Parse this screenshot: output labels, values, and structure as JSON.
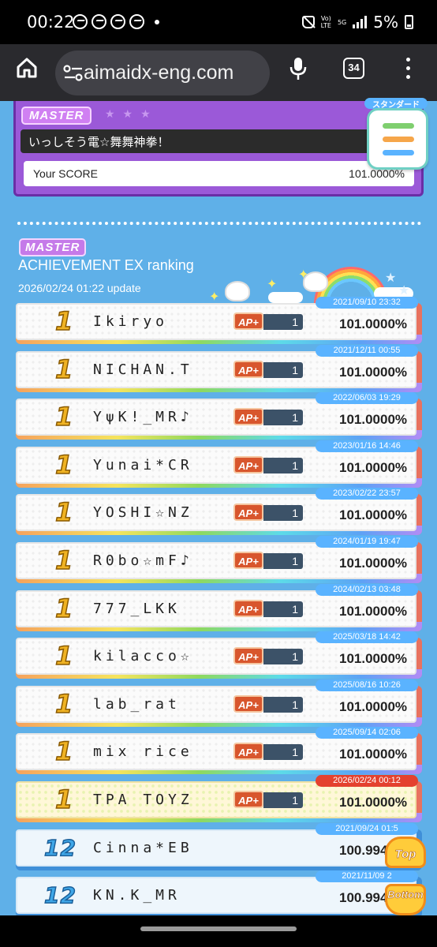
{
  "status_bar": {
    "time": "00:22",
    "network_top": "Vo)",
    "network_bottom": "LTE",
    "five_g": "5G",
    "battery": "5%",
    "notification_icons": [
      "whatsapp-icon",
      "messenger-icon",
      "messenger-icon",
      "messenger-icon"
    ]
  },
  "browser": {
    "url": "aimaidx-eng.com",
    "tab_count": "34"
  },
  "song": {
    "difficulty": "MASTER",
    "title": "いっしそう電☆舞舞神拳！",
    "score_label": "Your SCORE",
    "score_value": "101.0000%",
    "corner_badge": "スタンダード"
  },
  "ranking": {
    "difficulty": "MASTER",
    "title": "ACHIEVEMENT EX ranking",
    "updated": "2026/02/24 01:22 update",
    "ap_label": "AP+",
    "rows": [
      {
        "rank": "1",
        "name": "Ikiryo",
        "ap_count": "1",
        "date": "2021/09/10 23:32",
        "score": "101.0000%"
      },
      {
        "rank": "1",
        "name": "NICHAN.T",
        "ap_count": "1",
        "date": "2021/12/11 00:55",
        "score": "101.0000%"
      },
      {
        "rank": "1",
        "name": "YψK!_MR♪",
        "ap_count": "1",
        "date": "2022/06/03 19:29",
        "score": "101.0000%"
      },
      {
        "rank": "1",
        "name": "Yunai*CR",
        "ap_count": "1",
        "date": "2023/01/16 14:46",
        "score": "101.0000%"
      },
      {
        "rank": "1",
        "name": "YOSHI☆NZ",
        "ap_count": "1",
        "date": "2023/02/22 23:57",
        "score": "101.0000%"
      },
      {
        "rank": "1",
        "name": "R0bo☆mF♪",
        "ap_count": "1",
        "date": "2024/01/19 19:47",
        "score": "101.0000%"
      },
      {
        "rank": "1",
        "name": "777_LKK",
        "ap_count": "1",
        "date": "2024/02/13 03:48",
        "score": "101.0000%"
      },
      {
        "rank": "1",
        "name": "kilacco☆",
        "ap_count": "1",
        "date": "2025/03/18 14:42",
        "score": "101.0000%"
      },
      {
        "rank": "1",
        "name": "lab_rat",
        "ap_count": "1",
        "date": "2025/08/16 10:26",
        "score": "101.0000%"
      },
      {
        "rank": "1",
        "name": "mix rice",
        "ap_count": "1",
        "date": "2025/09/14 02:06",
        "score": "101.0000%"
      },
      {
        "rank": "1",
        "name": "TPA TOYZ",
        "ap_count": "1",
        "date": "2026/02/24 00:12",
        "score": "101.0000%"
      },
      {
        "rank": "12",
        "name": "Cinna*EB",
        "date": "2021/09/24 01:5",
        "score": "100.994"
      },
      {
        "rank": "12",
        "name": "KN.K_MR",
        "date": "2021/11/09 2",
        "score": "100.9946"
      }
    ]
  },
  "floating": {
    "top_label": "Top",
    "bottom_label": "Bottom"
  },
  "colors": {
    "background": "#5fb0e8",
    "master_purple": "#9b59d8",
    "date_badge": "#5ab3ff",
    "highlight_date_badge": "#e4412f",
    "ap_badge": "#d8562d"
  }
}
